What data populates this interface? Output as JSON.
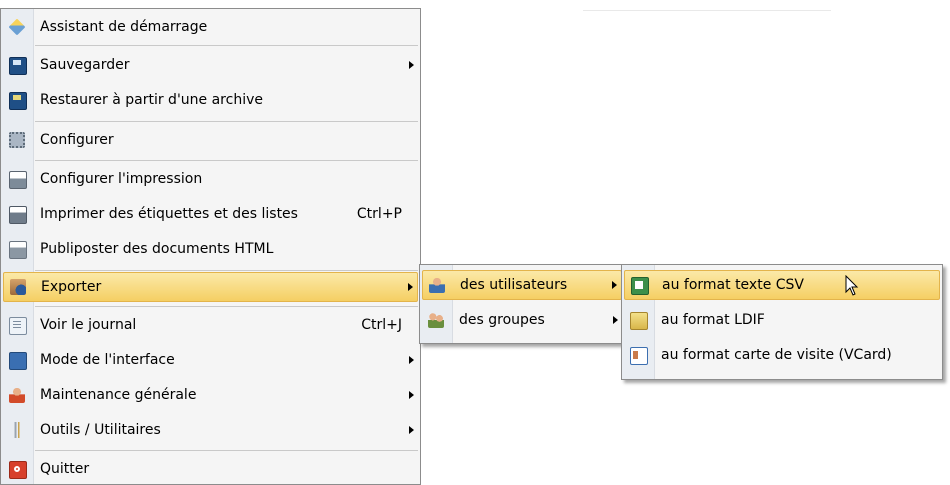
{
  "main_menu": {
    "items": [
      {
        "label": "Assistant de démarrage",
        "icon": "wand-icon"
      },
      {
        "label": "Sauvegarder",
        "icon": "save-disk-icon",
        "has_submenu": true
      },
      {
        "label": "Restaurer à partir d'une archive",
        "icon": "restore-disk-icon"
      },
      {
        "label": "Configurer",
        "icon": "gear-icon"
      },
      {
        "label": "Configurer l'impression",
        "icon": "print-settings-icon"
      },
      {
        "label": "Imprimer des étiquettes et des listes",
        "shortcut": "Ctrl+P",
        "icon": "printer-icon"
      },
      {
        "label": "Publiposter des documents HTML",
        "icon": "mail-merge-icon"
      },
      {
        "label": "Exporter",
        "icon": "export-icon",
        "has_submenu": true,
        "active": true
      },
      {
        "label": "Voir le journal",
        "shortcut": "Ctrl+J",
        "icon": "journal-icon"
      },
      {
        "label": "Mode de l'interface",
        "icon": "monitor-icon",
        "has_submenu": true
      },
      {
        "label": "Maintenance générale",
        "icon": "maintenance-user-icon",
        "has_submenu": true
      },
      {
        "label": "Outils / Utilitaires",
        "icon": "tools-icon",
        "has_submenu": true
      },
      {
        "label": "Quitter",
        "icon": "quit-icon"
      }
    ]
  },
  "export_submenu": {
    "items": [
      {
        "label": "des utilisateurs",
        "icon": "user-icon",
        "has_submenu": true,
        "active": true
      },
      {
        "label": "des groupes",
        "icon": "group-icon",
        "has_submenu": true
      }
    ]
  },
  "users_submenu": {
    "items": [
      {
        "label": "au format texte CSV",
        "icon": "csv-spreadsheet-icon",
        "active": true
      },
      {
        "label": "au format LDIF",
        "icon": "ldif-file-icon"
      },
      {
        "label": "au format carte de visite (VCard)",
        "icon": "vcard-icon"
      }
    ]
  },
  "colors": {
    "menu_background": "#f5f5f5",
    "gutter": "#e9edf2",
    "highlight_top": "#fbe9a8",
    "highlight_bottom": "#f5cf63",
    "highlight_border": "#e3b44b"
  }
}
